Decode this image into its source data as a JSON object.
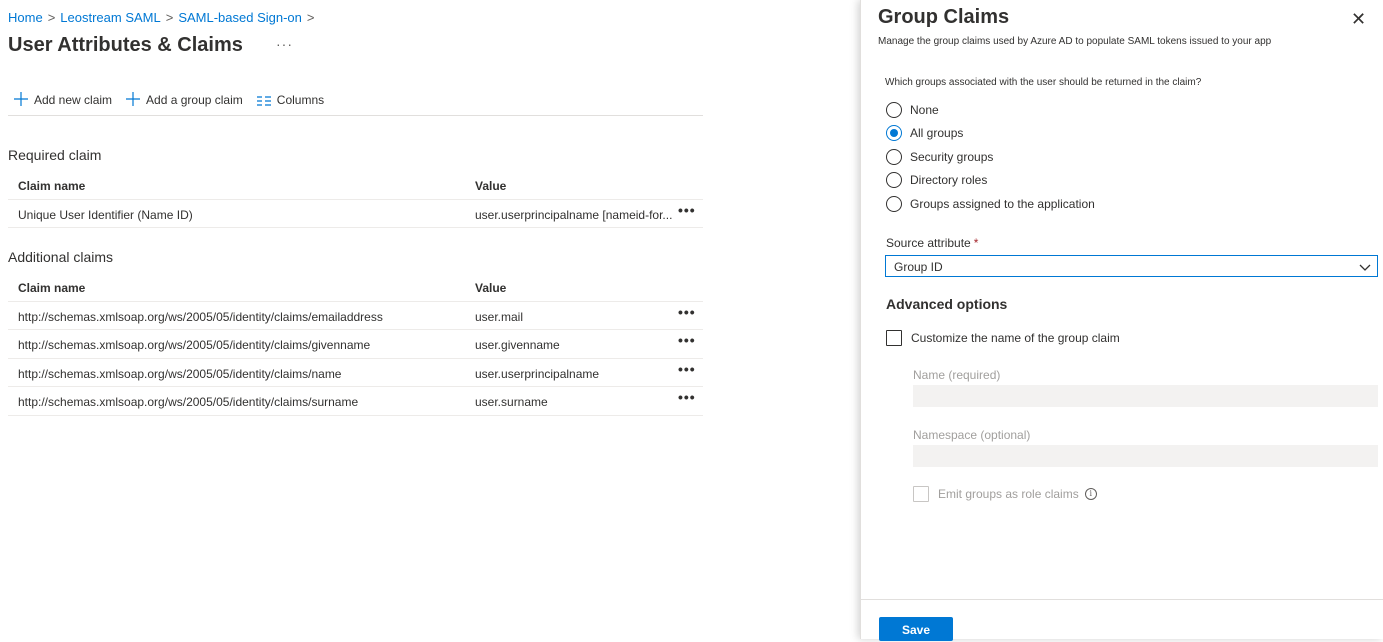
{
  "breadcrumb": {
    "items": [
      "Home",
      "Leostream SAML",
      "SAML-based Sign-on"
    ],
    "separator": ">"
  },
  "page": {
    "title": "User Attributes & Claims",
    "more_label": "···"
  },
  "toolbar": {
    "add_claim": "Add new claim",
    "add_group_claim": "Add a group claim",
    "columns": "Columns"
  },
  "required_claim": {
    "title": "Required claim",
    "columns": [
      "Claim name",
      "Value"
    ],
    "rows": [
      {
        "name": "Unique User Identifier (Name ID)",
        "value": "user.userprincipalname [nameid-for..."
      }
    ]
  },
  "additional_claims": {
    "title": "Additional claims",
    "columns": [
      "Claim name",
      "Value"
    ],
    "rows": [
      {
        "name": "http://schemas.xmlsoap.org/ws/2005/05/identity/claims/emailaddress",
        "value": "user.mail"
      },
      {
        "name": "http://schemas.xmlsoap.org/ws/2005/05/identity/claims/givenname",
        "value": "user.givenname"
      },
      {
        "name": "http://schemas.xmlsoap.org/ws/2005/05/identity/claims/name",
        "value": "user.userprincipalname"
      },
      {
        "name": "http://schemas.xmlsoap.org/ws/2005/05/identity/claims/surname",
        "value": "user.surname"
      }
    ]
  },
  "row_menu_label": "•••",
  "panel": {
    "title": "Group Claims",
    "subtitle": "Manage the group claims used by Azure AD to populate SAML tokens issued to your app",
    "close_label": "✕",
    "question": "Which groups associated with the user should be returned in the claim?",
    "options": [
      "None",
      "All groups",
      "Security groups",
      "Directory roles",
      "Groups assigned to the application"
    ],
    "selected_option": "All groups",
    "source_attribute_label": "Source attribute",
    "required_marker": "*",
    "source_attribute_value": "Group ID",
    "advanced_title": "Advanced options",
    "customize_label": "Customize the name of the group claim",
    "customize_checked": false,
    "name_label": "Name (required)",
    "namespace_label": "Namespace (optional)",
    "emit_label": "Emit groups as role claims",
    "emit_checked": false,
    "save_label": "Save"
  },
  "colors": {
    "accent": "#0078d4",
    "text": "#323130",
    "disabled_text": "#a19f9d",
    "required": "#a4262c"
  },
  "icons": [
    "plus-icon",
    "columns-icon",
    "more-icon",
    "close-icon",
    "chevron-down-icon",
    "info-icon"
  ]
}
